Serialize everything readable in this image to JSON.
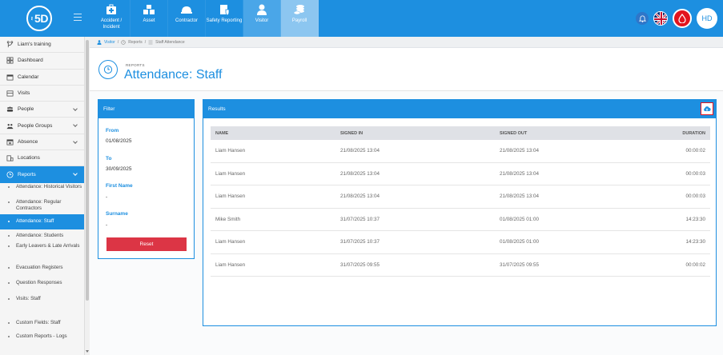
{
  "brand": {
    "logo_text": "5D",
    "logo_small": "Inter"
  },
  "modules": [
    {
      "label": "Accident / Incident",
      "icon": "first-aid-kit-icon"
    },
    {
      "label": "Asset",
      "icon": "boxes-icon"
    },
    {
      "label": "Contractor",
      "icon": "hard-hat-icon"
    },
    {
      "label": "Safety Reporting",
      "icon": "clipboard-shield-icon"
    },
    {
      "label": "Visitor",
      "icon": "person-icon"
    },
    {
      "label": "Payroll",
      "icon": "coins-icon"
    }
  ],
  "user": {
    "initials": "HD"
  },
  "sidebar": {
    "items": [
      {
        "label": "Liam's training",
        "icon": "branch-icon"
      },
      {
        "label": "Dashboard",
        "icon": "dashboard-icon"
      },
      {
        "label": "Calendar",
        "icon": "calendar-icon"
      },
      {
        "label": "Visits",
        "icon": "visits-icon"
      },
      {
        "label": "People",
        "icon": "people-icon"
      },
      {
        "label": "People Groups",
        "icon": "people-groups-icon"
      },
      {
        "label": "Absence",
        "icon": "absence-icon"
      },
      {
        "label": "Locations",
        "icon": "building-icon"
      },
      {
        "label": "Reports",
        "icon": "clock-icon"
      }
    ],
    "sub_items": [
      "Attendance: Historical Visitors",
      "Attendance: Regular Contractors",
      "Attendance: Staff",
      "Attendance: Students",
      "Early Leavers & Late Arrivals",
      "Evacuation Registers",
      "Question Responses",
      "Visits: Staff",
      "Custom Fields: Staff",
      "Custom Reports - Logs"
    ]
  },
  "breadcrumb": {
    "visitor": "Visitor",
    "reports": "Reports",
    "current": "Staff Attendance"
  },
  "page": {
    "kicker": "REPORTS",
    "title": "Attendance: Staff"
  },
  "filter": {
    "title": "Filter",
    "from_label": "From",
    "from_value": "01/08/2025",
    "to_label": "To",
    "to_value": "30/09/2025",
    "first_name_label": "First Name",
    "first_name_value": "-",
    "surname_label": "Surname",
    "surname_value": "-",
    "reset_label": "Reset"
  },
  "results": {
    "title": "Results",
    "columns": [
      "NAME",
      "SIGNED IN",
      "SIGNED OUT",
      "DURATION"
    ],
    "rows": [
      [
        "Liam Hansen",
        "21/08/2025 13:04",
        "21/08/2025 13:04",
        "00:00:02"
      ],
      [
        "Liam Hansen",
        "21/08/2025 13:04",
        "21/08/2025 13:04",
        "00:00:03"
      ],
      [
        "Liam Hansen",
        "21/08/2025 13:04",
        "21/08/2025 13:04",
        "00:00:03"
      ],
      [
        "Mike Smith",
        "31/07/2025 10:37",
        "01/08/2025 01:00",
        "14:23:30"
      ],
      [
        "Liam Hansen",
        "31/07/2025 10:37",
        "01/08/2025 01:00",
        "14:23:30"
      ],
      [
        "Liam Hansen",
        "31/07/2025 09:55",
        "31/07/2025 09:55",
        "00:00:02"
      ]
    ]
  },
  "colors": {
    "primary": "#1d8fe0",
    "danger": "#dc3545",
    "alert": "#e2141e"
  }
}
